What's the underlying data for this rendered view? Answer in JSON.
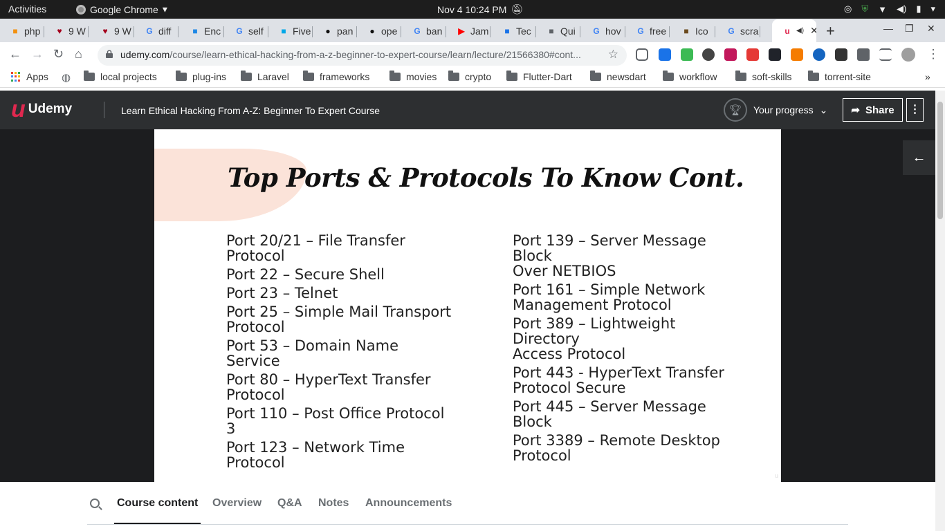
{
  "system": {
    "activities": "Activities",
    "app_name": "Google Chrome",
    "clock": "Nov 4  10:24 PM"
  },
  "tabs": [
    {
      "label": "php",
      "icon": "php-icon",
      "color": "#f29111"
    },
    {
      "label": "9 W",
      "icon": "heart-icon",
      "color": "#a4001b"
    },
    {
      "label": "9 W",
      "icon": "heart-icon",
      "color": "#a4001b"
    },
    {
      "label": "diff",
      "icon": "google-icon",
      "color": "#4285f4"
    },
    {
      "label": "Enc",
      "icon": "diamond-icon",
      "color": "#1e88e5"
    },
    {
      "label": "self",
      "icon": "google-icon",
      "color": "#4285f4"
    },
    {
      "label": "Five",
      "icon": "bolt-icon",
      "color": "#00a8e8"
    },
    {
      "label": "pan",
      "icon": "github-icon",
      "color": "#111111"
    },
    {
      "label": "ope",
      "icon": "github-icon",
      "color": "#111111"
    },
    {
      "label": "ban",
      "icon": "google-icon",
      "color": "#4285f4"
    },
    {
      "label": "Jam",
      "icon": "youtube-icon",
      "color": "#ff0000"
    },
    {
      "label": "Tec",
      "icon": "calendar-icon",
      "color": "#1a73e8"
    },
    {
      "label": "Qui",
      "icon": "globe-icon",
      "color": "#5f6368"
    },
    {
      "label": "hov",
      "icon": "google-icon",
      "color": "#4285f4"
    },
    {
      "label": "free",
      "icon": "google-icon",
      "color": "#4285f4"
    },
    {
      "label": "Ico",
      "icon": "image-icon",
      "color": "#6b4a1e"
    },
    {
      "label": "scra",
      "icon": "google-icon",
      "color": "#4285f4"
    }
  ],
  "active_tab": {
    "icon": "udemy-icon",
    "color": "#e0284f"
  },
  "address": {
    "host": "udemy.com",
    "path": "/course/learn-ethical-hacking-from-a-z-beginner-to-expert-course/learn/lecture/21566380#cont..."
  },
  "bookmarks": {
    "apps": "Apps",
    "folders": [
      "local projects",
      "plug-ins",
      "Laravel",
      "frameworks",
      "movies",
      "crypto",
      "Flutter-Dart",
      "newsdart",
      "workflow",
      "soft-skills",
      "torrent-site"
    ]
  },
  "udemy": {
    "logo_text": "Udemy",
    "course_title": "Learn Ethical Hacking From A-Z: Beginner To Expert Course",
    "progress_label": "Your progress",
    "share_label": "Share",
    "brand_color": "#e0284f"
  },
  "slide": {
    "title": "Top Ports & Protocols To Know Cont.",
    "left_column": [
      [
        "Port 20/21 – File Transfer",
        "Protocol"
      ],
      [
        "Port 22 – Secure Shell"
      ],
      [
        "Port 23 – Telnet"
      ],
      [
        "Port 25 – Simple Mail Transport",
        "Protocol"
      ],
      [
        "Port 53 – Domain Name Service"
      ],
      [
        "Port 80 – HyperText Transfer",
        "Protocol"
      ],
      [
        "Port 110 – Post Office Protocol 3"
      ],
      [
        "Port 123 – Network Time",
        "Protocol"
      ]
    ],
    "right_column": [
      [
        "Port 139 – Server Message Block",
        "Over NETBIOS"
      ],
      [
        "Port 161 – Simple Network",
        "Management Protocol"
      ],
      [
        "Port 389 – Lightweight Directory",
        "Access Protocol"
      ],
      [
        "Port 443 - HyperText Transfer",
        "Protocol Secure"
      ],
      [
        "Port 445 – Server Message Block"
      ],
      [
        "Port 3389 – Remote Desktop",
        "Protocol"
      ]
    ]
  },
  "bottom_tabs": [
    "Course content",
    "Overview",
    "Q&A",
    "Notes",
    "Announcements"
  ]
}
